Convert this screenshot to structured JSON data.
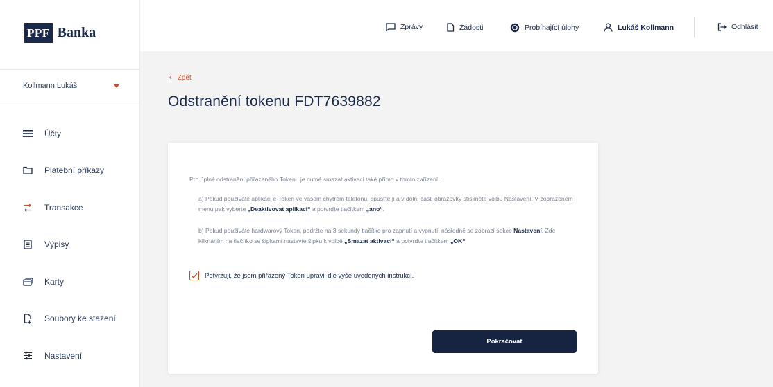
{
  "brand": {
    "logo_box": "PPF",
    "logo_text": "Banka"
  },
  "user_select": {
    "value": "Kollmann Lukáš"
  },
  "sidebar": {
    "items": [
      {
        "label": "Účty",
        "icon": "menu-icon"
      },
      {
        "label": "Platební příkazy",
        "icon": "folder-icon"
      },
      {
        "label": "Transakce",
        "icon": "transfer-icon"
      },
      {
        "label": "Výpisy",
        "icon": "document-icon"
      },
      {
        "label": "Karty",
        "icon": "card-icon"
      },
      {
        "label": "Soubory ke stažení",
        "icon": "file-download-icon"
      },
      {
        "label": "Nastavení",
        "icon": "sliders-icon"
      }
    ]
  },
  "header": {
    "messages": "Zprávy",
    "requests": "Žádosti",
    "tasks": "Probíhající úlohy",
    "user": "Lukáš Kollmann",
    "logout": "Odhlásit"
  },
  "main": {
    "back": "Zpět",
    "title": "Odstranění tokenu FDT7639882",
    "intro": "Pro úplné odstranění přiřazeného Tokenu je nutné smazat aktivaci také přímo v tomto zařízení:",
    "a": {
      "text1": "a) Pokud používáte aplikaci e-Token ve vašem chytrém telefonu, spusťte ji a v dolní části obrazovky stiskněte volbu Nastavení. V zobrazeném menu pak vyberte ",
      "bold1": "„Deaktivovat aplikaci“",
      "text2": " a potvrďte tlačítkem ",
      "bold2": "„ano“",
      "text3": "."
    },
    "b": {
      "text1": "b) Pokud používáte hardwarový Token, podržte na 3 sekundy tlačítko pro zapnutí a vypnutí, následně se zobrazí sekce ",
      "bold1": "Nastavení",
      "text2": ". Zde kliknáním na tlačítko se šipkami nastavte šipku k volbě ",
      "bold2": "„Smazat aktivaci“",
      "text3": " a potvrďte tlačítkem ",
      "bold3": "„OK“",
      "text4": "."
    },
    "confirm_label": "Potvrzuji, že jsem přiřazený Token upravil dle výše uvedených instrukcí.",
    "confirm_checked": true,
    "continue": "Pokračovat"
  },
  "colors": {
    "navy": "#162442",
    "accent": "#c0522b",
    "bg": "#f3f3f3"
  }
}
